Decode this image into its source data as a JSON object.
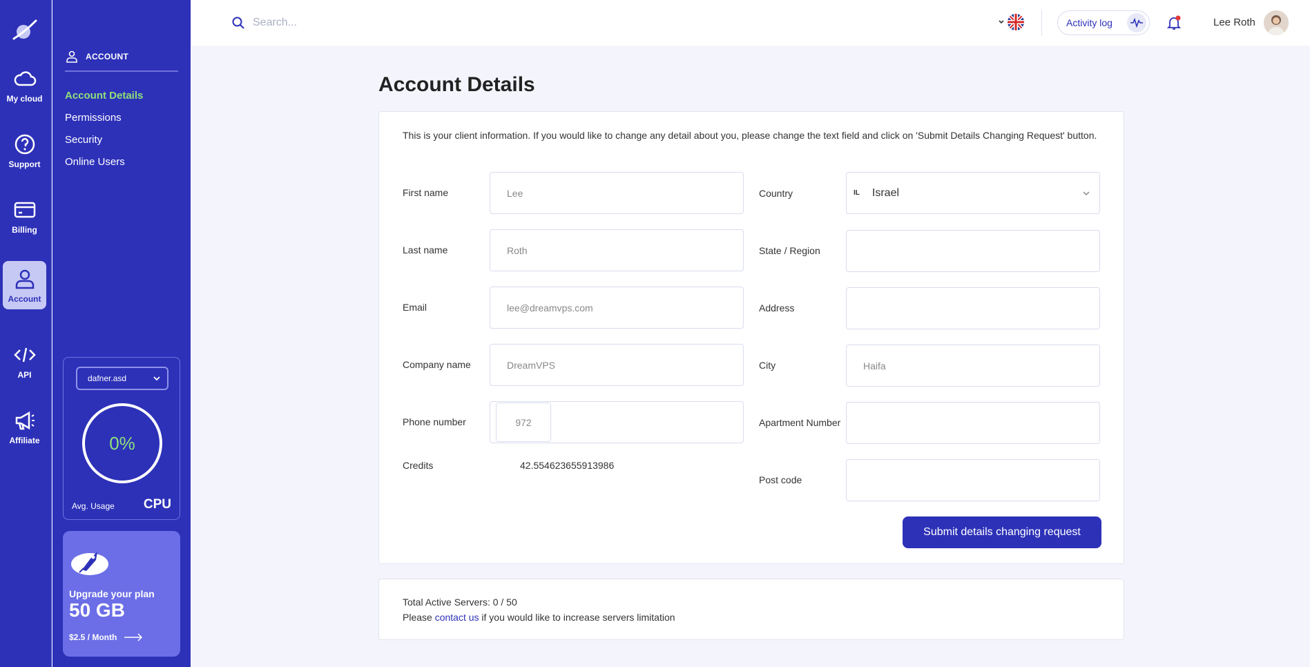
{
  "rail": {
    "items": [
      {
        "label": "My cloud",
        "icon": "cloud-icon"
      },
      {
        "label": "Support",
        "icon": "question-icon"
      },
      {
        "label": "Billing",
        "icon": "card-icon"
      },
      {
        "label": "Account",
        "icon": "user-icon",
        "active": true
      },
      {
        "label": "API",
        "icon": "code-icon"
      },
      {
        "label": "Affiliate",
        "icon": "megaphone-icon"
      }
    ]
  },
  "subnav": {
    "heading": "ACCOUNT",
    "links": [
      "Account Details",
      "Permissions",
      "Security",
      "Online Users"
    ],
    "active": "Account Details"
  },
  "cpu": {
    "server": "dafner.asd",
    "percent": "0%",
    "avg_label": "Avg. Usage",
    "label": "CPU"
  },
  "upgrade": {
    "title": "Upgrade your plan",
    "size": "50 GB",
    "price": "$2.5 / Month"
  },
  "topbar": {
    "search_placeholder": "Search...",
    "language_flag": "uk-flag-icon",
    "activity_label": "Activity log",
    "username": "Lee Roth"
  },
  "page": {
    "title": "Account Details",
    "intro": "This is your client information. If you would like to change any detail about you, please change the text field and click on 'Submit Details Changing Request' button."
  },
  "form": {
    "left": [
      {
        "label": "First name",
        "value": "Lee"
      },
      {
        "label": "Last name",
        "value": "Roth"
      },
      {
        "label": "Email",
        "value": "lee@dreamvps.com"
      },
      {
        "label": "Company name",
        "value": "DreamVPS"
      },
      {
        "label": "Phone number",
        "prefix": "972",
        "value": ""
      }
    ],
    "credits_label": "Credits",
    "credits_value": "42.554623655913986",
    "right": [
      {
        "label": "Country",
        "code": "IL",
        "value": "Israel"
      },
      {
        "label": "State / Region",
        "value": ""
      },
      {
        "label": "Address",
        "value": ""
      },
      {
        "label": "City",
        "value": "Haifa"
      },
      {
        "label": "Apartment Number",
        "value": ""
      },
      {
        "label": "Post code",
        "value": ""
      }
    ],
    "submit_label": "Submit details changing request"
  },
  "servers": {
    "line1": "Total Active Servers: 0 / 50",
    "prefix": "Please ",
    "link": "contact us",
    "suffix": " if you would like to increase servers limitation"
  },
  "colors": {
    "primary": "#2d31b8",
    "accent_green": "#8ee07a",
    "upgrade_bg": "#6b6ee6"
  }
}
